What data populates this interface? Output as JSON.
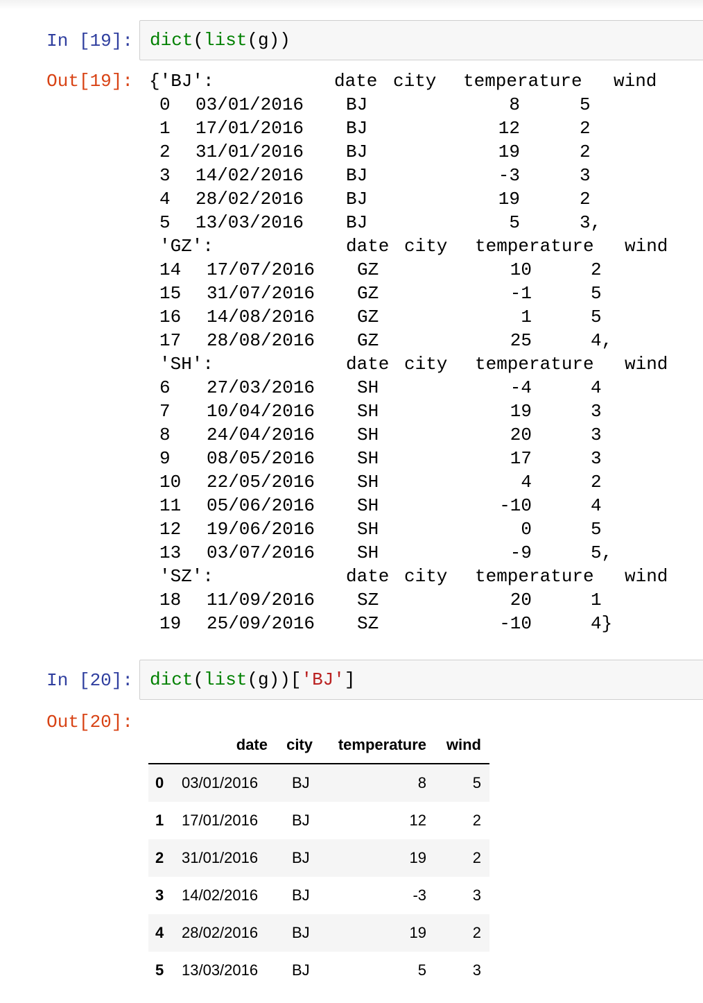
{
  "cells": [
    {
      "prompt_in": "In [19]:",
      "code": {
        "fn1": "dict",
        "p1": "(",
        "fn2": "list",
        "p2": "(g))",
        "str": "",
        "p3": ""
      },
      "prompt_out": "Out[19]:",
      "output_groups": [
        {
          "key": "{'BJ':",
          "header": [
            "date",
            "city",
            "temperature",
            "wind"
          ],
          "rows": [
            [
              "0",
              "03/01/2016",
              "BJ",
              "8",
              "5"
            ],
            [
              "1",
              "17/01/2016",
              "BJ",
              "12",
              "2"
            ],
            [
              "2",
              "31/01/2016",
              "BJ",
              "19",
              "2"
            ],
            [
              "3",
              "14/02/2016",
              "BJ",
              "-3",
              "3"
            ],
            [
              "4",
              "28/02/2016",
              "BJ",
              "19",
              "2"
            ],
            [
              "5",
              "13/03/2016",
              "BJ",
              "5",
              "3,"
            ]
          ]
        },
        {
          "key": "'GZ':",
          "header": [
            "date",
            "city",
            "temperature",
            "wind"
          ],
          "rows": [
            [
              "14",
              "17/07/2016",
              "GZ",
              "10",
              "2"
            ],
            [
              "15",
              "31/07/2016",
              "GZ",
              "-1",
              "5"
            ],
            [
              "16",
              "14/08/2016",
              "GZ",
              "1",
              "5"
            ],
            [
              "17",
              "28/08/2016",
              "GZ",
              "25",
              "4,"
            ]
          ]
        },
        {
          "key": "'SH':",
          "header": [
            "date",
            "city",
            "temperature",
            "wind"
          ],
          "rows": [
            [
              "6",
              "27/03/2016",
              "SH",
              "-4",
              "4"
            ],
            [
              "7",
              "10/04/2016",
              "SH",
              "19",
              "3"
            ],
            [
              "8",
              "24/04/2016",
              "SH",
              "20",
              "3"
            ],
            [
              "9",
              "08/05/2016",
              "SH",
              "17",
              "3"
            ],
            [
              "10",
              "22/05/2016",
              "SH",
              "4",
              "2"
            ],
            [
              "11",
              "05/06/2016",
              "SH",
              "-10",
              "4"
            ],
            [
              "12",
              "19/06/2016",
              "SH",
              "0",
              "5"
            ],
            [
              "13",
              "03/07/2016",
              "SH",
              "-9",
              "5,"
            ]
          ]
        },
        {
          "key": "'SZ':",
          "header": [
            "date",
            "city",
            "temperature",
            "wind"
          ],
          "rows": [
            [
              "18",
              "11/09/2016",
              "SZ",
              "20",
              "1"
            ],
            [
              "19",
              "25/09/2016",
              "SZ",
              "-10",
              "4}"
            ]
          ]
        }
      ]
    },
    {
      "prompt_in": "In [20]:",
      "code": {
        "fn1": "dict",
        "p1": "(",
        "fn2": "list",
        "p2": "(g))[",
        "str": "'BJ'",
        "p3": "]"
      },
      "prompt_out": "Out[20]:",
      "table": {
        "columns": [
          "date",
          "city",
          "temperature",
          "wind"
        ],
        "rows": [
          {
            "index": "0",
            "date": "03/01/2016",
            "city": "BJ",
            "temperature": "8",
            "wind": "5"
          },
          {
            "index": "1",
            "date": "17/01/2016",
            "city": "BJ",
            "temperature": "12",
            "wind": "2"
          },
          {
            "index": "2",
            "date": "31/01/2016",
            "city": "BJ",
            "temperature": "19",
            "wind": "2"
          },
          {
            "index": "3",
            "date": "14/02/2016",
            "city": "BJ",
            "temperature": "-3",
            "wind": "3"
          },
          {
            "index": "4",
            "date": "28/02/2016",
            "city": "BJ",
            "temperature": "19",
            "wind": "2"
          },
          {
            "index": "5",
            "date": "13/03/2016",
            "city": "BJ",
            "temperature": "5",
            "wind": "3"
          }
        ]
      }
    }
  ],
  "colors": {
    "prompt_in": "#303F9F",
    "prompt_out": "#D84315",
    "builtin": "#008000",
    "string": "#BA2121"
  }
}
